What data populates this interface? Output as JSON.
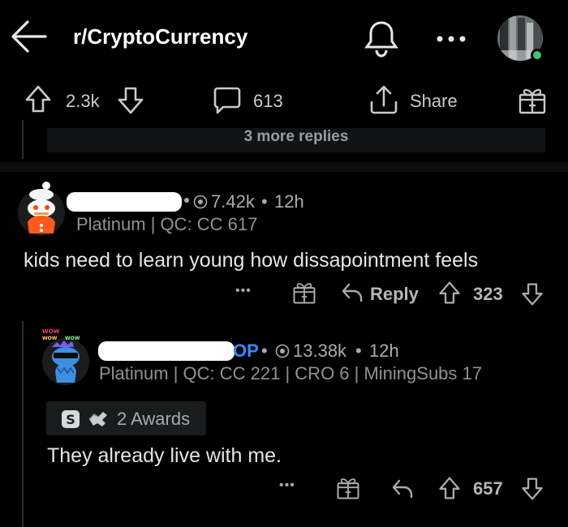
{
  "header": {
    "title": "r/CryptoCurrency",
    "back_icon": "arrow-left-icon",
    "bell_icon": "bell-icon",
    "more_icon": "more-horizontal-icon",
    "online_color": "#3ec66a"
  },
  "post_actions": {
    "upvotes": "2.3k",
    "comments": "613",
    "share_label": "Share"
  },
  "more_replies": "3 more replies",
  "comment1": {
    "karma": "7.42k",
    "age": "12h",
    "flair": "Platinum | QC: CC 617",
    "text": "kids need to learn young how dissapointment feels",
    "reply_label": "Reply",
    "score": "323",
    "separator": "•",
    "more": "•••"
  },
  "comment2": {
    "op_badge": "OP",
    "karma": "13.38k",
    "age": "12h",
    "flair": "Platinum | QC: CC 221 | CRO 6 | MiningSubs 17",
    "awards": "2 Awards",
    "text": "They already live with me.",
    "score": "657",
    "separator": "•",
    "more": "•••"
  },
  "colors": {
    "background": "#000000",
    "accent_op": "#2f8eff",
    "text": "#d7dadc"
  }
}
